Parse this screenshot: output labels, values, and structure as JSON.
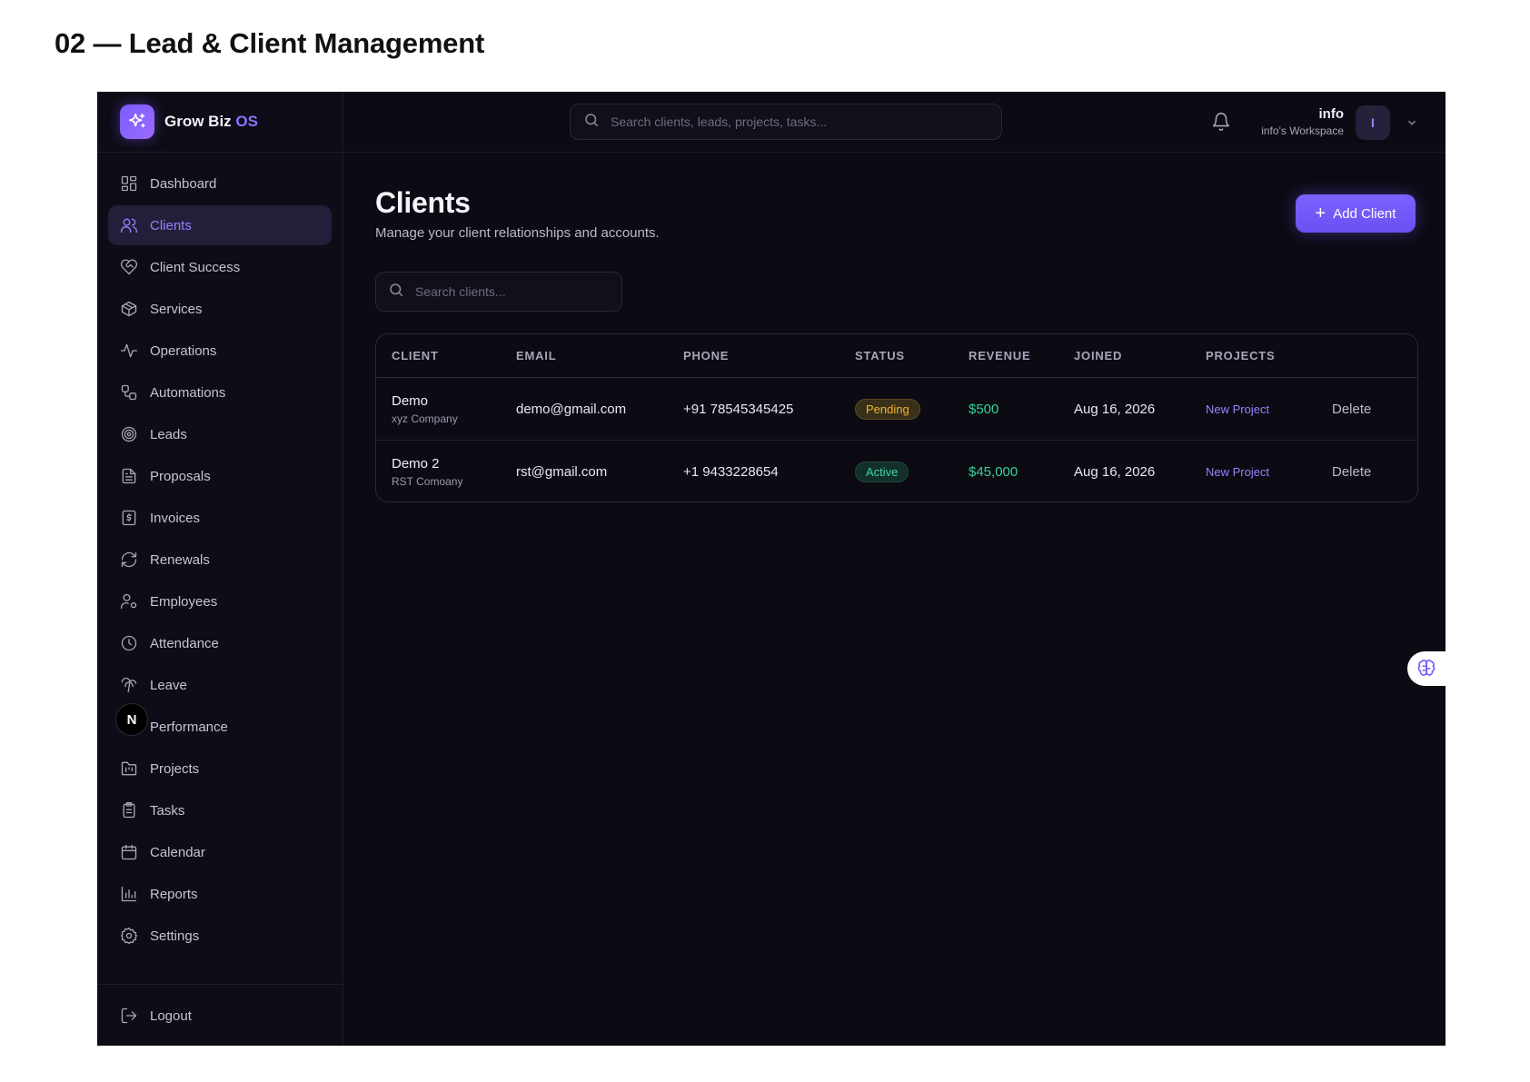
{
  "document": {
    "title": "02 — Lead & Client Management"
  },
  "brand": {
    "name": "Grow Biz",
    "accent": "OS",
    "icon": "sparkle-icon"
  },
  "sidebar": {
    "items": [
      {
        "label": "Dashboard",
        "icon": "dashboard-icon"
      },
      {
        "label": "Clients",
        "icon": "users-icon",
        "active": true
      },
      {
        "label": "Client Success",
        "icon": "heart-handshake-icon"
      },
      {
        "label": "Services",
        "icon": "package-icon"
      },
      {
        "label": "Operations",
        "icon": "activity-icon"
      },
      {
        "label": "Automations",
        "icon": "workflow-icon"
      },
      {
        "label": "Leads",
        "icon": "target-icon"
      },
      {
        "label": "Proposals",
        "icon": "file-text-icon"
      },
      {
        "label": "Invoices",
        "icon": "receipt-icon"
      },
      {
        "label": "Renewals",
        "icon": "refresh-icon"
      },
      {
        "label": "Employees",
        "icon": "user-cog-icon"
      },
      {
        "label": "Attendance",
        "icon": "clock-icon"
      },
      {
        "label": "Leave",
        "icon": "palm-tree-icon"
      },
      {
        "label": "Performance",
        "icon": "trend-icon"
      },
      {
        "label": "Projects",
        "icon": "folder-kanban-icon"
      },
      {
        "label": "Tasks",
        "icon": "clipboard-list-icon"
      },
      {
        "label": "Calendar",
        "icon": "calendar-icon"
      },
      {
        "label": "Reports",
        "icon": "bar-chart-icon"
      },
      {
        "label": "Settings",
        "icon": "gear-icon"
      }
    ],
    "logout": {
      "label": "Logout",
      "icon": "logout-icon"
    },
    "overlay_badge": "N"
  },
  "header": {
    "search_placeholder": "Search clients, leads, projects, tasks...",
    "user_name": "info",
    "workspace": "info's Workspace",
    "avatar_initial": "I"
  },
  "main": {
    "title": "Clients",
    "subtitle": "Manage your client relationships and accounts.",
    "add_button": "Add Client",
    "search_placeholder": "Search clients..."
  },
  "table": {
    "columns": [
      "CLIENT",
      "EMAIL",
      "PHONE",
      "STATUS",
      "REVENUE",
      "JOINED",
      "PROJECTS"
    ],
    "rows": [
      {
        "name": "Demo",
        "company": "xyz Company",
        "email": "demo@gmail.com",
        "phone": "+91 78545345425",
        "status": "Pending",
        "revenue": "$500",
        "joined": "Aug 16, 2026",
        "project": "New Project",
        "action": "Delete"
      },
      {
        "name": "Demo 2",
        "company": "RST Comoany",
        "email": "rst@gmail.com",
        "phone": "+1 9433228654",
        "status": "Active",
        "revenue": "$45,000",
        "joined": "Aug 16, 2026",
        "project": "New Project",
        "action": "Delete"
      }
    ]
  },
  "colors": {
    "accent": "#8f72ff",
    "background": "#0c0a13",
    "revenue": "#34d399",
    "pending": "#f0b432",
    "active": "#3dd6a0"
  }
}
